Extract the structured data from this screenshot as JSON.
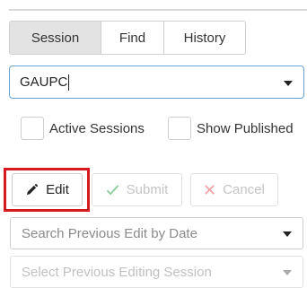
{
  "tabs": [
    {
      "label": "Session",
      "active": true
    },
    {
      "label": "Find",
      "active": false
    },
    {
      "label": "History",
      "active": false
    }
  ],
  "session_select": {
    "value": "GAUPC"
  },
  "checkboxes": {
    "active_sessions": {
      "label": "Active Sessions",
      "checked": false
    },
    "show_published": {
      "label": "Show Published",
      "checked": false
    }
  },
  "actions": {
    "edit_label": "Edit",
    "submit_label": "Submit",
    "cancel_label": "Cancel"
  },
  "dropdowns": {
    "date_placeholder": "Search Previous Edit by Date",
    "session_placeholder": "Select Previous Editing Session"
  },
  "colors": {
    "highlight": "#d71920",
    "focus_border": "#66a3d9",
    "active_tab_bg": "#e3e3e3",
    "disabled_text": "#c4c4c4"
  }
}
